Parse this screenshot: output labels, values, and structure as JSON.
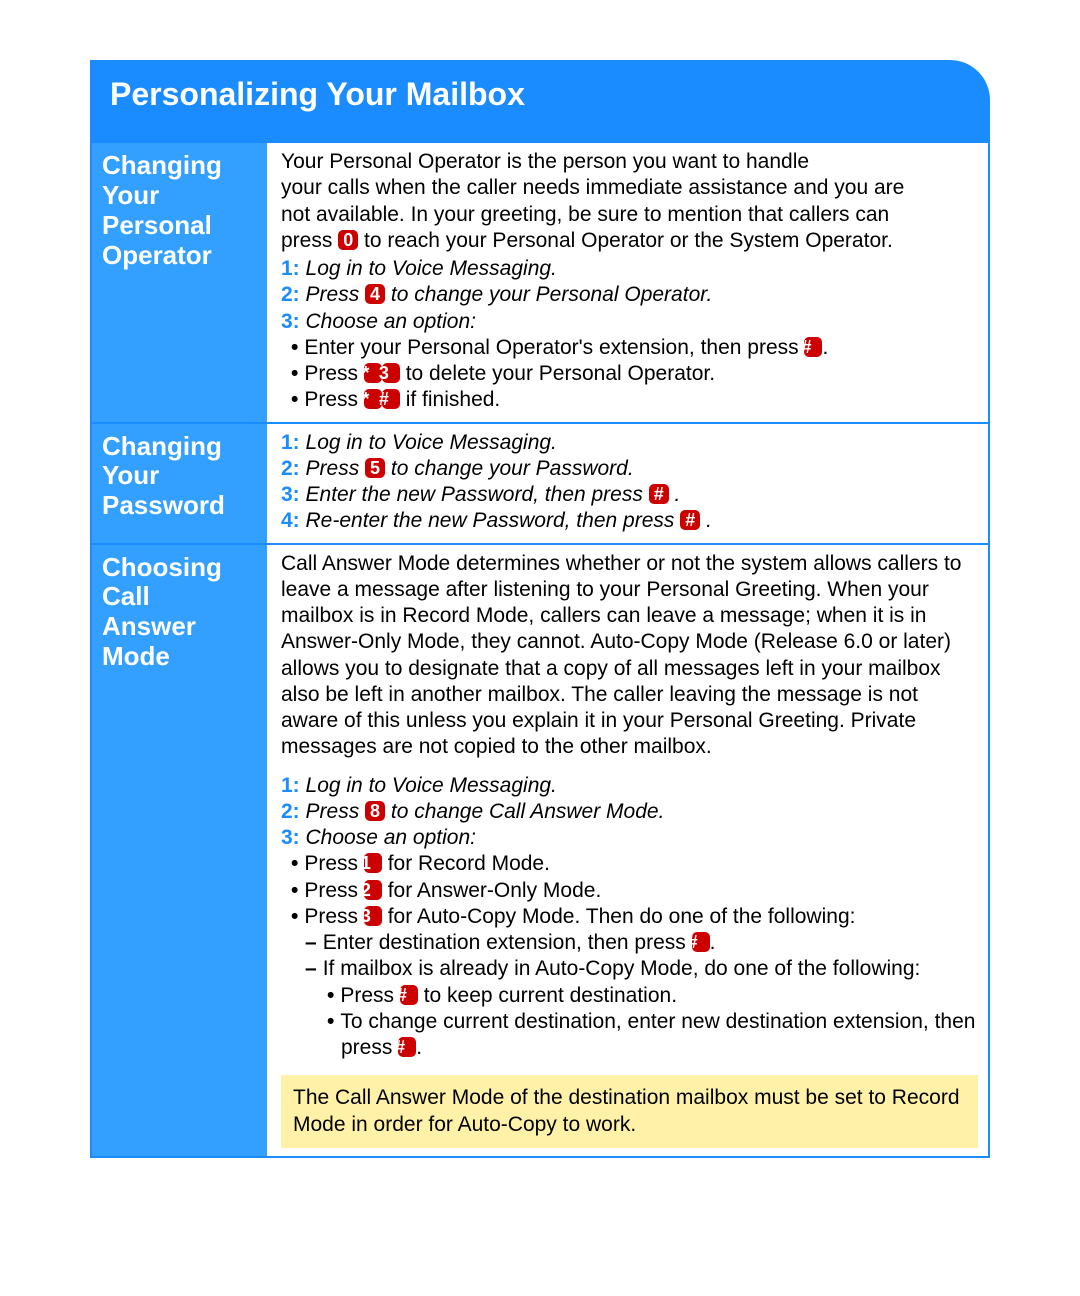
{
  "title": "Personalizing Your Mailbox",
  "keys": {
    "zero": "0",
    "one": "1",
    "two": "2",
    "three": "3",
    "four": "4",
    "five": "5",
    "eight": "8",
    "star": "*",
    "hash": "#"
  },
  "sections": {
    "operator": {
      "label_l1": "Changing",
      "label_l2": "Your",
      "label_l3": "Personal",
      "label_l4": "Operator",
      "intro_a": "Your Personal Operator is the person you want to handle",
      "intro_b": "your calls when the caller needs immediate assistance and you are",
      "intro_c": "not available. In your greeting, be sure to mention that callers can",
      "intro_d_pre": "press ",
      "intro_d_post": " to reach your Personal Operator or the System Operator.",
      "s1": "Log in to Voice Messaging.",
      "s2_pre": "Press ",
      "s2_post": " to change your Personal Operator.",
      "s3": "Choose an option:",
      "b1_pre": "Enter your Personal Operator's extension, then press ",
      "b1_post": ".",
      "b2_pre": "Press ",
      "b2_post": " to delete your Personal Operator.",
      "b3_pre": "Press ",
      "b3_post": " if finished."
    },
    "password": {
      "label_l1": "Changing",
      "label_l2": "Your",
      "label_l3": "Password",
      "s1": "Log in to Voice Messaging.",
      "s2_pre": "Press ",
      "s2_post": " to change your Password.",
      "s3_pre": "Enter the new Password, then press ",
      "s3_post": " .",
      "s4_pre": "Re-enter the new Password, then press ",
      "s4_post": " ."
    },
    "mode": {
      "label_l1": "Choosing",
      "label_l2": "Call",
      "label_l3": "Answer",
      "label_l4": "Mode",
      "intro": "Call Answer Mode determines whether or not the system allows callers to leave a message after listening to your Personal Greeting. When your mailbox is in Record Mode, callers can leave a message; when it is in Answer-Only Mode, they cannot. Auto-Copy Mode (Release 6.0 or later) allows you to designate that a copy of all messages left in your mailbox also be left in another mailbox. The caller leaving the message is not aware of this unless you explain it in your Personal Greeting. Private messages are not copied to the other mailbox.",
      "s1": "Log in to Voice Messaging.",
      "s2_pre": "Press ",
      "s2_post": " to change Call Answer Mode.",
      "s3": "Choose an option:",
      "b1_pre": "Press ",
      "b1_post": " for Record Mode.",
      "b2_pre": "Press ",
      "b2_post": " for Answer-Only Mode.",
      "b3_pre": "Press ",
      "b3_post": " for Auto-Copy Mode. Then do one of the following:",
      "d1_pre": "Enter destination extension, then press ",
      "d1_post": ".",
      "d2": "If mailbox is already in Auto-Copy Mode, do one of the following:",
      "sb1_pre": "Press ",
      "sb1_post": " to keep current destination.",
      "sb2_pre": "To change current destination, enter new destination extension, then press ",
      "sb2_post": ".",
      "warn": "The Call Answer Mode of the destination mailbox must be set to Record Mode in order for Auto-Copy to work."
    }
  }
}
